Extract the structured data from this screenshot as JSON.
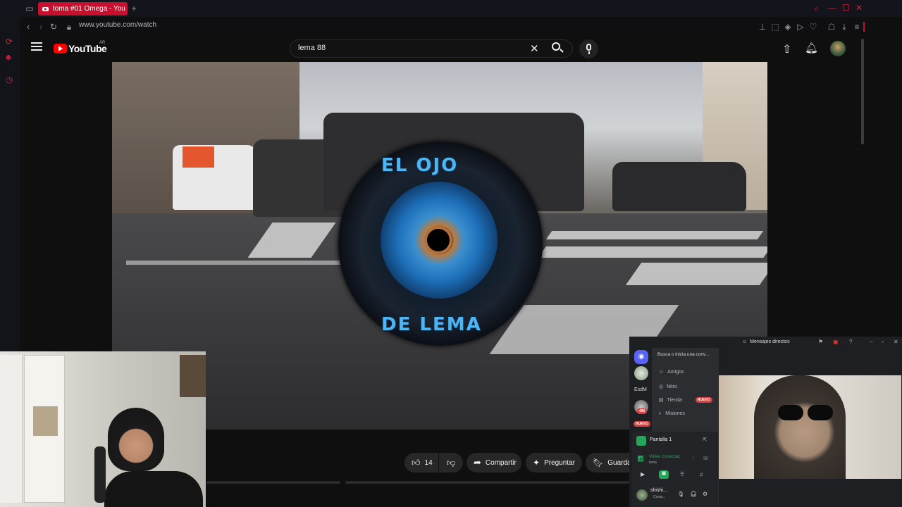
{
  "browser": {
    "tab_title": "toma #01 Omega - You",
    "url": "www.youtube.com/watch",
    "new_tab": "+"
  },
  "youtube": {
    "logo_text": "YouTube",
    "country_code": "AR",
    "search_value": "lema 88",
    "search_icon": "search-icon",
    "mic_icon": "mic-icon"
  },
  "video": {
    "logo_top": "EL OJO",
    "logo_bottom": "DE LEMA"
  },
  "actions": {
    "like_count": "14",
    "share_label": "Compartir",
    "ask_label": "Preguntar",
    "save_label": "Guardar"
  },
  "discord": {
    "title": "Mensajes directos",
    "search_placeholder": "Busca o inicia una conv...",
    "server_label": "EsdM",
    "server_badge": "496",
    "server_new": "NUEVO",
    "items": [
      {
        "label": "Amigos"
      },
      {
        "label": "Nitro"
      },
      {
        "label": "Tienda",
        "badge": "NUEVO"
      },
      {
        "label": "Misiones"
      }
    ],
    "screen_label": "Pantalla 1",
    "voice_status": "Video conectac",
    "voice_channel": "lema",
    "user_name": "shishi...",
    "user_status": "Comp..."
  },
  "colors": {
    "opera_red": "#c8102e",
    "youtube_red": "#ff0000",
    "discord_blurple": "#5865f2",
    "discord_green": "#23a55a",
    "logo_blue": "#4fb4f0"
  }
}
